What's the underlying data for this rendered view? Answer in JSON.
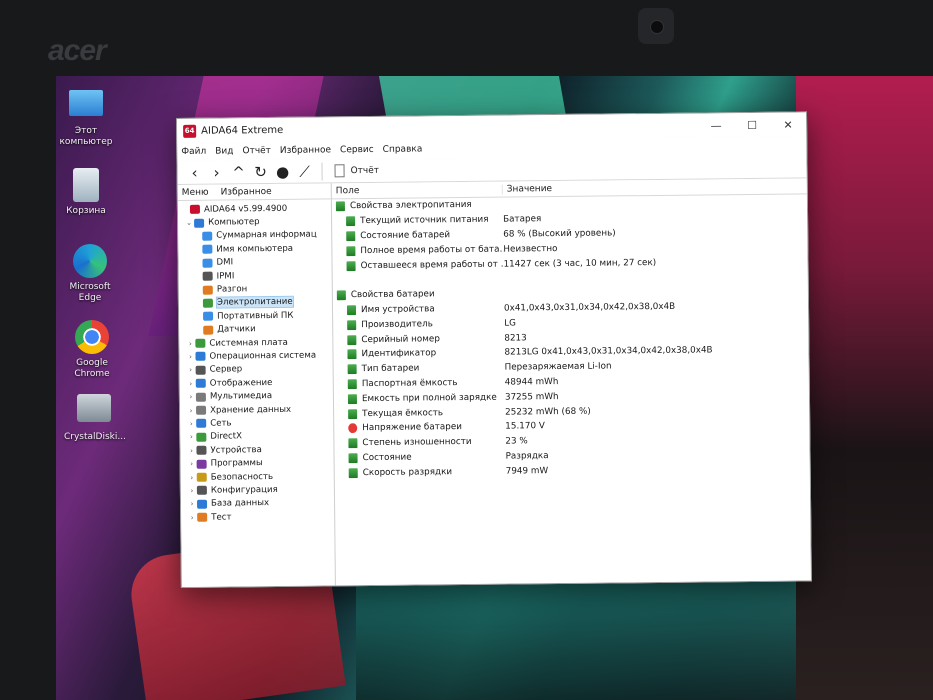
{
  "bezel": {
    "brand": "acer"
  },
  "desktop": {
    "icons": [
      {
        "label": "Этот компьютер",
        "icon": "monitor-icon"
      },
      {
        "label": "Корзина",
        "icon": "recycle-bin-icon"
      },
      {
        "label": "Microsoft Edge",
        "icon": "edge-icon"
      },
      {
        "label": "Google Chrome",
        "icon": "chrome-icon"
      },
      {
        "label": "CrystalDiski...",
        "icon": "crystaldisk-icon"
      }
    ]
  },
  "window": {
    "app_badge": "64",
    "title": "AIDA64 Extreme",
    "controls": {
      "minimize": "—",
      "maximize": "☐",
      "close": "✕"
    },
    "menu": [
      "Файл",
      "Вид",
      "Отчёт",
      "Избранное",
      "Сервис",
      "Справка"
    ],
    "toolbar": {
      "report_label": "Отчёт",
      "icons": [
        "back-icon",
        "forward-icon",
        "up-icon",
        "refresh-icon",
        "user-icon",
        "graph-icon"
      ]
    }
  },
  "left_panel": {
    "tabs": [
      "Меню",
      "Избранное"
    ],
    "tree": [
      {
        "label": "AIDA64 v5.99.4900",
        "level": 0,
        "chev": "",
        "color": "#c8102e"
      },
      {
        "label": "Компьютер",
        "level": 1,
        "chev": "⌄",
        "color": "#2e7bd6"
      },
      {
        "label": "Суммарная информац",
        "level": 2,
        "chev": "",
        "color": "#3a8ee6"
      },
      {
        "label": "Имя компьютера",
        "level": 2,
        "chev": "",
        "color": "#3a8ee6"
      },
      {
        "label": "DMI",
        "level": 2,
        "chev": "",
        "color": "#3a8ee6"
      },
      {
        "label": "IPMI",
        "level": 2,
        "chev": "",
        "color": "#555555"
      },
      {
        "label": "Разгон",
        "level": 2,
        "chev": "",
        "color": "#e07b22"
      },
      {
        "label": "Электропитание",
        "level": 2,
        "chev": "",
        "color": "#3c9a3c",
        "selected": true
      },
      {
        "label": "Портативный ПК",
        "level": 2,
        "chev": "",
        "color": "#3a8ee6"
      },
      {
        "label": "Датчики",
        "level": 2,
        "chev": "",
        "color": "#e07b22"
      },
      {
        "label": "Системная плата",
        "level": 1,
        "chev": "›",
        "color": "#3c9a3c"
      },
      {
        "label": "Операционная система",
        "level": 1,
        "chev": "›",
        "color": "#2e7bd6"
      },
      {
        "label": "Сервер",
        "level": 1,
        "chev": "›",
        "color": "#555555"
      },
      {
        "label": "Отображение",
        "level": 1,
        "chev": "›",
        "color": "#2e7bd6"
      },
      {
        "label": "Мультимедиа",
        "level": 1,
        "chev": "›",
        "color": "#7a7a7a"
      },
      {
        "label": "Хранение данных",
        "level": 1,
        "chev": "›",
        "color": "#7a7a7a"
      },
      {
        "label": "Сеть",
        "level": 1,
        "chev": "›",
        "color": "#2e7bd6"
      },
      {
        "label": "DirectX",
        "level": 1,
        "chev": "›",
        "color": "#3c9a3c"
      },
      {
        "label": "Устройства",
        "level": 1,
        "chev": "›",
        "color": "#555555"
      },
      {
        "label": "Программы",
        "level": 1,
        "chev": "›",
        "color": "#7a3aa0"
      },
      {
        "label": "Безопасность",
        "level": 1,
        "chev": "›",
        "color": "#c89a1a"
      },
      {
        "label": "Конфигурация",
        "level": 1,
        "chev": "›",
        "color": "#555555"
      },
      {
        "label": "База данных",
        "level": 1,
        "chev": "›",
        "color": "#2e7bd6"
      },
      {
        "label": "Тест",
        "level": 1,
        "chev": "›",
        "color": "#e07b22"
      }
    ]
  },
  "right_panel": {
    "columns": {
      "field": "Поле",
      "value": "Значение"
    },
    "sections": [
      {
        "title": "Свойства электропитания",
        "rows": [
          {
            "field": "Текущий источник питания",
            "value": "Батарея",
            "icon": "green"
          },
          {
            "field": "Состояние батарей",
            "value": "68 % (Высокий уровень)",
            "icon": "green"
          },
          {
            "field": "Полное время работы от бата...",
            "value": "Неизвестно",
            "icon": "green"
          },
          {
            "field": "Оставшееся время работы от ...",
            "value": "11427 сек (3 час, 10 мин, 27 сек)",
            "icon": "green"
          }
        ]
      },
      {
        "title": "Свойства батареи",
        "rows": [
          {
            "field": "Имя устройства",
            "value": "0x41,0x43,0x31,0x34,0x42,0x38,0x4B",
            "icon": "green"
          },
          {
            "field": "Производитель",
            "value": "LG",
            "icon": "green"
          },
          {
            "field": "Серийный номер",
            "value": "8213",
            "icon": "green"
          },
          {
            "field": "Идентификатор",
            "value": "8213LG 0x41,0x43,0x31,0x34,0x42,0x38,0x4B",
            "icon": "green"
          },
          {
            "field": "Тип батареи",
            "value": "Перезаряжаемая Li-Ion",
            "icon": "green"
          },
          {
            "field": "Паспортная ёмкость",
            "value": "48944 mWh",
            "icon": "green"
          },
          {
            "field": "Ёмкость при полной зарядке",
            "value": "37255 mWh",
            "icon": "green"
          },
          {
            "field": "Текущая ёмкость",
            "value": "25232 mWh  (68 %)",
            "icon": "green"
          },
          {
            "field": "Напряжение батареи",
            "value": "15.170 V",
            "icon": "warn"
          },
          {
            "field": "Степень изношенности",
            "value": "23 %",
            "icon": "green"
          },
          {
            "field": "Состояние",
            "value": "Разрядка",
            "icon": "green"
          },
          {
            "field": "Скорость разрядки",
            "value": "7949 mW",
            "icon": "green"
          }
        ]
      }
    ]
  }
}
